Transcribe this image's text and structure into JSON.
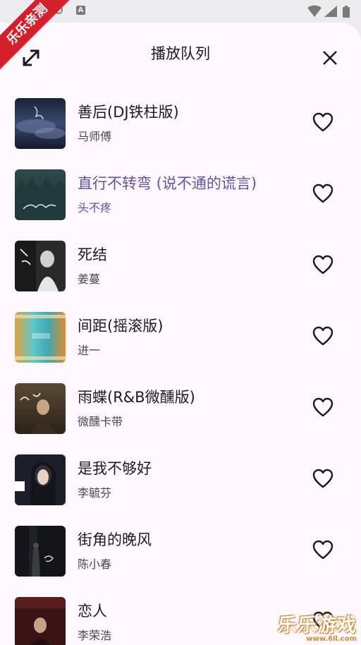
{
  "status_bar": {
    "icons": [
      "circle-icon",
      "a-notification-icon",
      "wifi-icon",
      "signal-icon",
      "battery-icon"
    ],
    "a_glyph": "A"
  },
  "header": {
    "title": "播放队列",
    "expand_icon": "expand-arrows-icon",
    "close_icon": "close-icon"
  },
  "accent_color": "#6750a4",
  "queue": [
    {
      "title": "善后(DJ铁柱版)",
      "artist": "马师傅",
      "active": false,
      "cover": "dark-blue-stormy-clouds"
    },
    {
      "title": "直行不转弯 (说不通的谎言)",
      "artist": "头不疼",
      "active": true,
      "cover": "teal-forest-handwriting"
    },
    {
      "title": "死结",
      "artist": "姜蔓",
      "active": false,
      "cover": "black-white-portrait"
    },
    {
      "title": "间距(摇滚版)",
      "artist": "进一",
      "active": false,
      "cover": "cyan-orange-film-strip"
    },
    {
      "title": "雨蝶(R&B微醺版)",
      "artist": "微醺卡带",
      "active": false,
      "cover": "warm-sepia-portrait"
    },
    {
      "title": "是我不够好",
      "artist": "李毓芬",
      "active": false,
      "cover": "dark-portrait-white-frame"
    },
    {
      "title": "街角的晚风",
      "artist": "陈小春",
      "active": false,
      "cover": "dark-night-figure"
    },
    {
      "title": "恋人",
      "artist": "李荣浩",
      "active": false,
      "cover": "dark-red-stage"
    }
  ],
  "watermark": {
    "ribbon_text": "乐乐亲测",
    "brand_text": "乐乐游戏",
    "brand_url": "www.6ll.com"
  }
}
